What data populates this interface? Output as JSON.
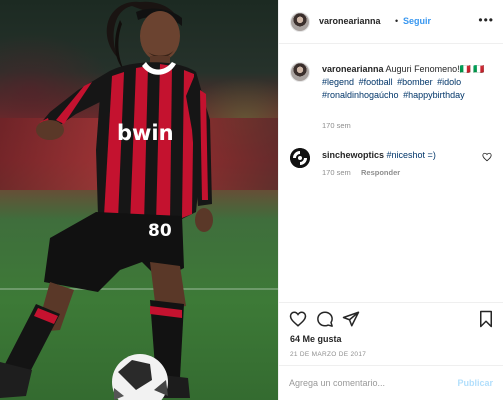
{
  "post": {
    "username": "varonearianna",
    "follow_label": "Seguir",
    "separator": "•",
    "more_label": "•••"
  },
  "caption": {
    "username": "varonearianna",
    "text": "Auguri Fenomeno!🇮🇹 🇮🇹",
    "hashtags": [
      "#legend",
      "#football",
      "#bomber",
      "#idolo",
      "#ronaldinhogaúcho",
      "#happybirthday"
    ],
    "time": "170 sem"
  },
  "comment": {
    "username": "sinchewoptics",
    "text": "#niceshot =)",
    "time": "170 sem",
    "reply_label": "Responder"
  },
  "stats": {
    "likes": "64 Me gusta",
    "date": "21 DE MARZO DE 2017"
  },
  "add_comment": {
    "placeholder": "Agrega un comentario...",
    "publish_label": "Publicar"
  },
  "photo": {
    "shirt_sponsor": "bwin",
    "shirt_number": "80"
  },
  "colors": {
    "link_blue": "#3897f0",
    "hashtag": "#003569",
    "muted": "#8e8e8e",
    "publish_disabled": "#b2dffc",
    "milan_red": "#c4122f"
  }
}
